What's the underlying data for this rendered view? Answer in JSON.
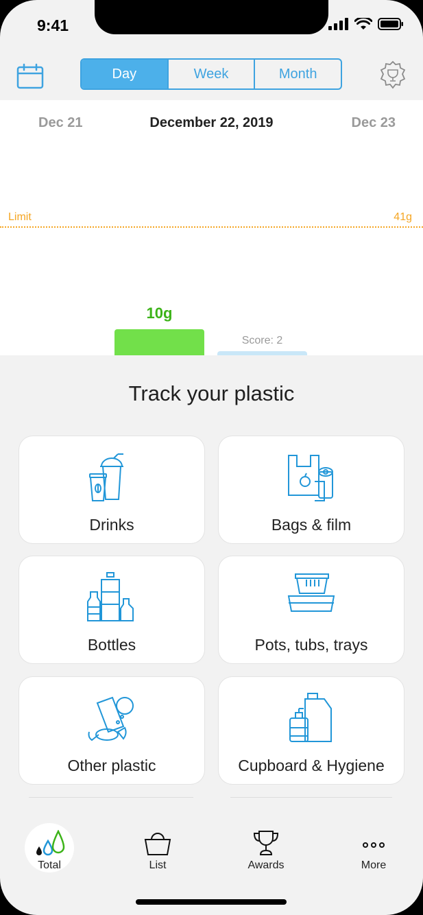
{
  "status_bar": {
    "time": "9:41"
  },
  "header": {
    "segments": [
      "Day",
      "Week",
      "Month"
    ],
    "active_segment": "Day"
  },
  "chart_data": {
    "type": "bar",
    "date_prev": "Dec 21",
    "date_current": "December 22, 2019",
    "date_next": "Dec 23",
    "limit_label": "Limit",
    "limit_value": "41g",
    "limit": 41,
    "categories": [
      "December 22, 2019"
    ],
    "values": [
      10
    ],
    "bar_label": "10g",
    "score_label": "Score:  2",
    "score": 2
  },
  "main": {
    "title": "Track your plastic",
    "categories": [
      {
        "label": "Drinks",
        "icon": "drinks-cups-icon"
      },
      {
        "label": "Bags & film",
        "icon": "bag-film-icon"
      },
      {
        "label": "Bottles",
        "icon": "bottles-icon"
      },
      {
        "label": "Pots, tubs, trays",
        "icon": "pots-tubs-trays-icon"
      },
      {
        "label": "Other plastic",
        "icon": "other-plastic-icon"
      },
      {
        "label": "Cupboard & Hygiene",
        "icon": "cupboard-hygiene-icon"
      }
    ]
  },
  "tabbar": {
    "items": [
      {
        "label": "Total",
        "icon": "drops-icon"
      },
      {
        "label": "List",
        "icon": "basket-icon"
      },
      {
        "label": "Awards",
        "icon": "trophy-icon"
      },
      {
        "label": "More",
        "icon": "ellipsis-icon"
      }
    ]
  },
  "colors": {
    "accent": "#4cb0ea",
    "limit": "#f5a623",
    "bar": "#72e04a",
    "bar_text": "#3cb318"
  }
}
